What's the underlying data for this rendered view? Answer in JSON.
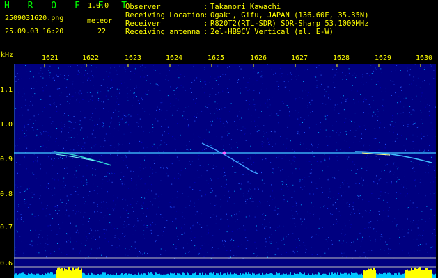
{
  "header": {
    "app_logo": "H R O F F T",
    "app_version": "1.0.0",
    "filename": "2509031620.png",
    "datetime": "25.09.03 16:20",
    "meteor_label": "meteor",
    "meteor_count": "22"
  },
  "info": {
    "rows": [
      {
        "key": "Observer",
        "value": "Takanori Kawachi"
      },
      {
        "key": "Receiving Location",
        "value": "Ogaki, Gifu, JAPAN (136.60E, 35.35N)"
      },
      {
        "key": "Receiver",
        "value": "R820T2(RTL-SDR) SDR-Sharp 53.1000MHz"
      },
      {
        "key": "Receiving antenna",
        "value": "2el-HB9CV Vertical (el. E-W)"
      }
    ]
  },
  "axis": {
    "y_unit": "kHz",
    "x_ticks": [
      "1621",
      "1622",
      "1623",
      "1624",
      "1625",
      "1626",
      "1627",
      "1628",
      "1629",
      "1630"
    ],
    "y_ticks": [
      "1.1",
      "1.0",
      "0.9",
      "0.8",
      "0.7",
      "0.6"
    ]
  },
  "colors": {
    "label": "#ffff00",
    "logo": "#00ff00",
    "background": "#000080",
    "carrier": "#40c0ff",
    "meteor_head": "#ff60ff",
    "level_fill": "#00c8ff",
    "level_peak": "#ffff00"
  }
}
